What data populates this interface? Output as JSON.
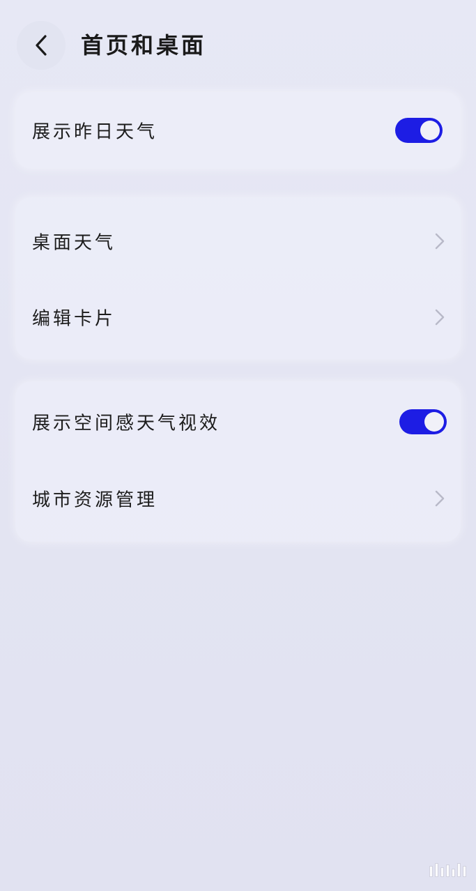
{
  "header": {
    "title": "首页和桌面",
    "back_icon": "chevron-left-icon"
  },
  "groups": [
    {
      "items": [
        {
          "label": "展示昨日天气",
          "control": "toggle",
          "on": true
        }
      ]
    },
    {
      "items": [
        {
          "label": "桌面天气",
          "control": "chevron"
        },
        {
          "label": "编辑卡片",
          "control": "chevron"
        }
      ]
    },
    {
      "items": [
        {
          "label": "展示空间感天气视效",
          "control": "toggle",
          "on": true
        },
        {
          "label": "城市资源管理",
          "control": "chevron"
        }
      ]
    }
  ],
  "colors": {
    "toggle_on": "#1d1de4",
    "background": "#e5e6f4",
    "card": "#ecedf8",
    "chevron": "#b8b9c8"
  }
}
